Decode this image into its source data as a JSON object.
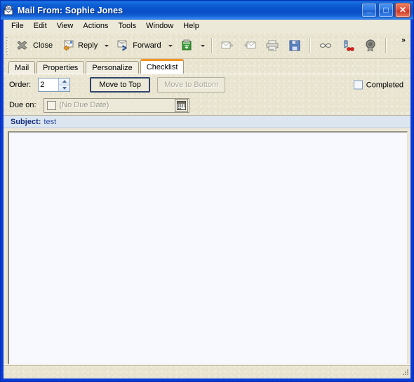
{
  "window": {
    "title": "Mail From: Sophie Jones",
    "icon": "mail-icon",
    "buttons": {
      "minimize": "_",
      "maximize": "□",
      "close": "✕"
    }
  },
  "menubar": {
    "items": [
      {
        "label": "File"
      },
      {
        "label": "Edit"
      },
      {
        "label": "View"
      },
      {
        "label": "Actions"
      },
      {
        "label": "Tools"
      },
      {
        "label": "Window"
      },
      {
        "label": "Help"
      }
    ]
  },
  "toolbar": {
    "close_label": "Close",
    "reply_label": "Reply",
    "forward_label": "Forward",
    "overflow_label": "»",
    "icons": {
      "close": "close-x-icon",
      "reply": "reply-icon",
      "forward": "forward-icon",
      "move": "move-to-folder-icon",
      "mark_unread": "mark-unread-icon",
      "mark_read": "mark-read-icon",
      "print": "print-icon",
      "save": "save-icon",
      "read_later": "glasses-icon",
      "signature": "signature-icon",
      "seal": "security-seal-icon"
    }
  },
  "tabs": [
    {
      "label": "Mail",
      "active": false
    },
    {
      "label": "Properties",
      "active": false
    },
    {
      "label": "Personalize",
      "active": false
    },
    {
      "label": "Checklist",
      "active": true
    }
  ],
  "checklist": {
    "order_label": "Order:",
    "order_value": "2",
    "move_to_top_label": "Move to Top",
    "move_to_bottom_label": "Move to Bottom",
    "move_to_bottom_disabled": true,
    "completed_label": "Completed",
    "completed_checked": false,
    "due_on_label": "Due on:",
    "due_on_value": "",
    "due_on_placeholder": "(No Due Date)",
    "due_on_checked": false,
    "calendar_icon": "calendar-icon"
  },
  "subject": {
    "label": "Subject:",
    "value": "test"
  },
  "body": {
    "value": "",
    "placeholder": ""
  },
  "statusbar": {
    "text": ""
  },
  "colors": {
    "titlebar_blue": "#0a53cc",
    "active_tab_accent": "#f29527",
    "form_background": "#e8e4cf",
    "subject_band": "#dce6f0",
    "subject_label": "#15307c",
    "body_background": "#f8f8ff"
  }
}
